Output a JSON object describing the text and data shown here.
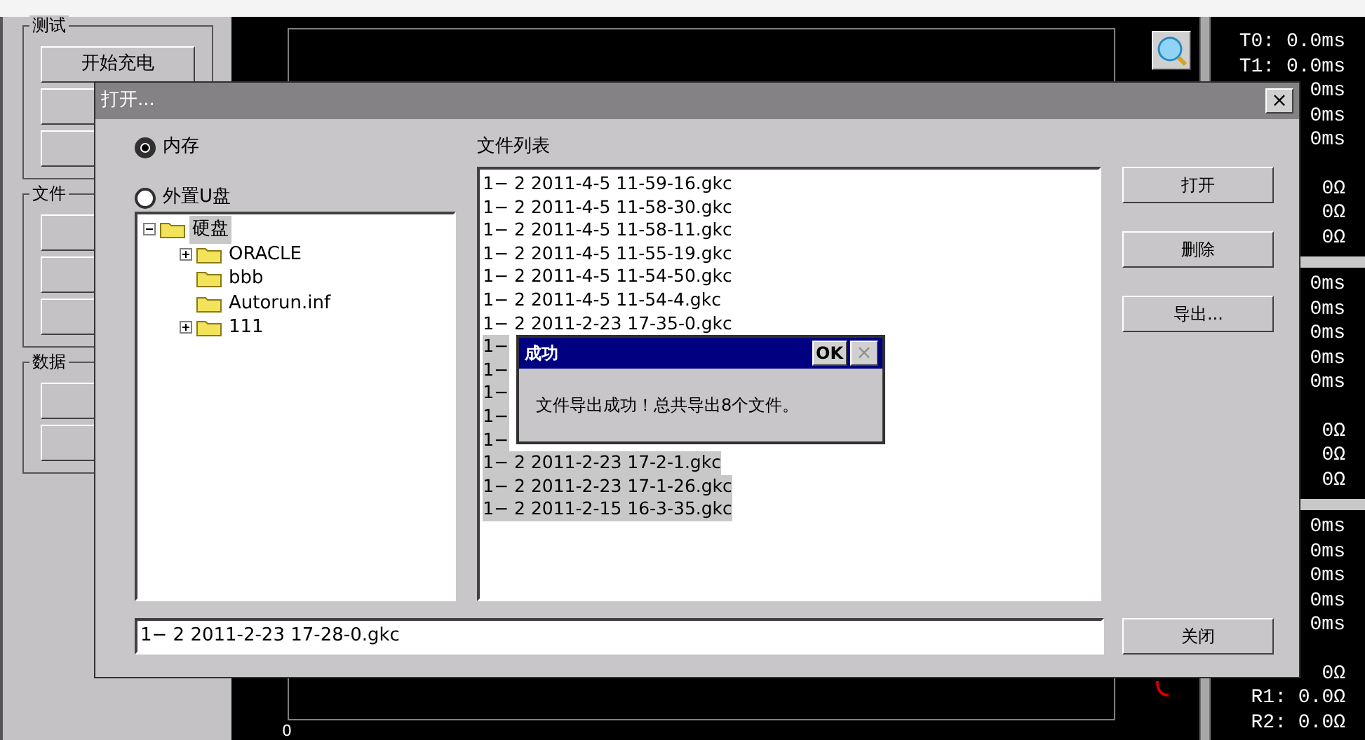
{
  "left_panel": {
    "groups": [
      {
        "title": "测试",
        "buttons": [
          {
            "kind": "labeled",
            "label": "开始充电"
          },
          {
            "kind": "covered"
          },
          {
            "kind": "covered"
          }
        ]
      },
      {
        "title": "文件",
        "buttons": [
          {
            "kind": "covered"
          },
          {
            "kind": "covered"
          },
          {
            "kind": "covered"
          }
        ]
      },
      {
        "title": "数据",
        "buttons": [
          {
            "kind": "covered"
          },
          {
            "kind": "covered"
          }
        ]
      }
    ]
  },
  "scope": {
    "axis_label": "0"
  },
  "readouts": {
    "groups": [
      {
        "times": [
          "T0: 0.0ms",
          "T1: 0.0ms",
          "0ms",
          "0ms",
          "0ms"
        ],
        "resistances": [
          "0Ω",
          "0Ω",
          "0Ω"
        ]
      },
      {
        "times": [
          "0ms",
          "0ms",
          "0ms",
          "0ms",
          "0ms"
        ],
        "resistances": [
          "0Ω",
          "0Ω",
          "0Ω"
        ]
      },
      {
        "times": [
          "0ms",
          "0ms",
          "0ms",
          "0ms",
          "0ms"
        ],
        "resistances": [
          "0Ω",
          "R1: 0.0Ω",
          "R2: 0.0Ω"
        ]
      }
    ]
  },
  "dialog": {
    "title": "打开...",
    "close": "×",
    "sources": [
      {
        "label": "内存",
        "selected": true
      },
      {
        "label": "外置U盘",
        "selected": false
      }
    ],
    "tree": [
      {
        "label": "硬盘",
        "selected": true,
        "expanded": true,
        "children": [
          {
            "label": "ORACLE",
            "selected": false,
            "expanded": false
          },
          {
            "label": "bbb",
            "selected": false
          },
          {
            "label": "Autorun.inf",
            "selected": false
          },
          {
            "label": "111",
            "selected": false,
            "expanded": false
          }
        ]
      }
    ],
    "file_list_label": "文件列表",
    "files": [
      {
        "name": "1− 2 2011-4-5 11-59-16.gkc",
        "selected": false
      },
      {
        "name": "1− 2 2011-4-5 11-58-30.gkc",
        "selected": false
      },
      {
        "name": "1− 2 2011-4-5 11-58-11.gkc",
        "selected": false
      },
      {
        "name": "1− 2 2011-4-5 11-55-19.gkc",
        "selected": false
      },
      {
        "name": "1− 2 2011-4-5 11-54-50.gkc",
        "selected": false
      },
      {
        "name": "1− 2 2011-4-5 11-54-4.gkc",
        "selected": false
      },
      {
        "name": "1− 2 2011-2-23 17-35-0.gkc",
        "selected": false
      },
      {
        "name": "1−",
        "selected": true
      },
      {
        "name": "1−",
        "selected": true
      },
      {
        "name": "1−",
        "selected": true
      },
      {
        "name": "1−",
        "selected": true
      },
      {
        "name": "1−",
        "selected": true
      },
      {
        "name": "1− 2 2011-2-23 17-2-1.gkc",
        "selected": true
      },
      {
        "name": "1− 2 2011-2-23 17-1-26.gkc",
        "selected": true
      },
      {
        "name": "1− 2 2011-2-15 16-3-35.gkc",
        "selected": true
      }
    ],
    "buttons": [
      "打开",
      "删除",
      "导出..."
    ],
    "filename": "1− 2 2011-2-23 17-28-0.gkc",
    "close_button": "关闭"
  },
  "message_box": {
    "title": "成功",
    "ok": "OK",
    "close": "×",
    "close_disabled": true,
    "message": "文件导出成功！总共导出8个文件。"
  }
}
